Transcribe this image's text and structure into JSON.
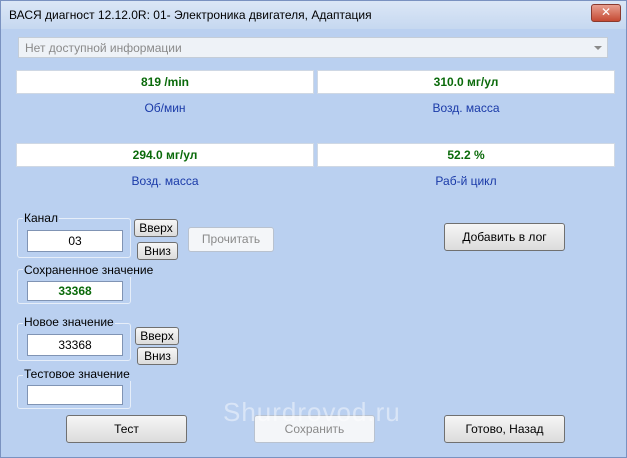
{
  "window": {
    "title": "ВАСЯ диагност 12.12.0R: 01- Электроника двигателя, Адаптация",
    "close_glyph": "✕"
  },
  "info_combo": {
    "value": "Нет доступной информации"
  },
  "readings": [
    {
      "value": "819 /min",
      "label": "Об/мин"
    },
    {
      "value": "310.0 мг/ул",
      "label": "Возд. масса"
    },
    {
      "value": "294.0 мг/ул",
      "label": "Возд. масса"
    },
    {
      "value": "52.2 %",
      "label": "Раб-й цикл"
    }
  ],
  "channel": {
    "label": "Канал",
    "value": "03",
    "up": "Вверх",
    "down": "Вниз",
    "read": "Прочитать"
  },
  "saved": {
    "label": "Сохраненное значение",
    "value": "33368"
  },
  "new_value": {
    "label": "Новое значение",
    "value": "33368",
    "up": "Вверх",
    "down": "Вниз"
  },
  "test_value": {
    "label": "Тестовое значение",
    "value": ""
  },
  "buttons": {
    "add_log": "Добавить в лог",
    "test": "Тест",
    "save": "Сохранить",
    "done": "Готово, Назад"
  },
  "watermark": "Shurdrovod.ru"
}
